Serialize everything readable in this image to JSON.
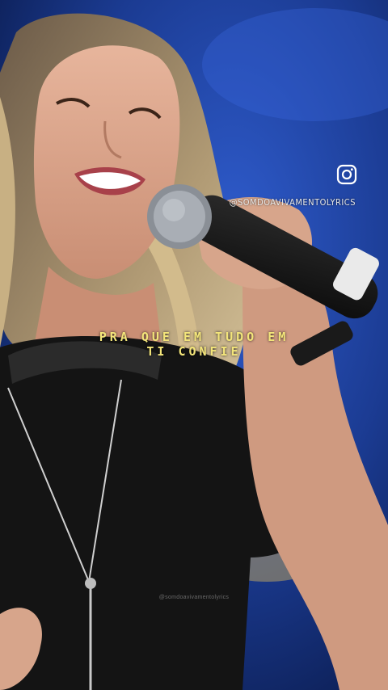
{
  "overlay": {
    "instagram_handle": "@SOMDOAVIVAMENTOLYRICS",
    "icon": "instagram-icon"
  },
  "lyrics": {
    "line1": "PRA QUE EM TUDO EM",
    "line2": "TI CONFIE"
  },
  "watermark": "@somdoavivamentolyrics",
  "colors": {
    "lyrics": "#f3e57a",
    "background": "#1d3f9a"
  }
}
